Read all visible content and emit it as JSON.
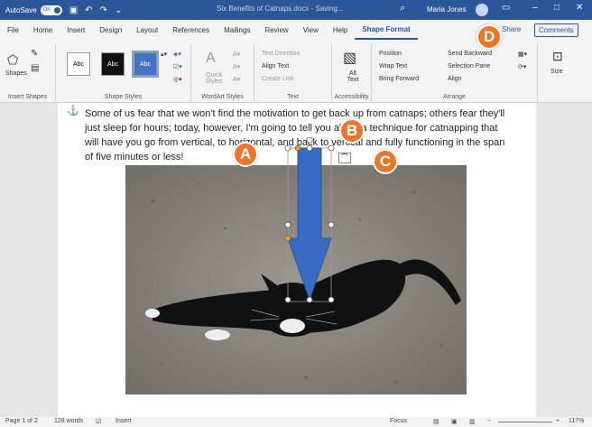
{
  "titlebar": {
    "autosave_label": "AutoSave",
    "autosave_state": "On",
    "doc_title": "Six Benefits of Catnaps.docx - Saving...",
    "user_name": "Maria Jones"
  },
  "tabs": [
    "File",
    "Home",
    "Insert",
    "Design",
    "Layout",
    "References",
    "Mailings",
    "Review",
    "View",
    "Help",
    "Shape Format"
  ],
  "active_tab": "Shape Format",
  "share_label": "Share",
  "comments_label": "Comments",
  "ribbon": {
    "insert_shapes": {
      "label": "Insert Shapes",
      "shapes_btn": "Shapes"
    },
    "shape_styles": {
      "label": "Shape Styles",
      "style1": "Abc",
      "style2": "Abc",
      "style3": "Abc"
    },
    "wordart_styles": {
      "label": "WordArt Styles",
      "quick_styles": "Quick Styles"
    },
    "text": {
      "label": "Text",
      "text_direction": "Text Direction",
      "align_text": "Align Text",
      "create_link": "Create Link"
    },
    "accessibility": {
      "label": "Accessibility",
      "alt_text": "Alt Text"
    },
    "arrange": {
      "label": "Arrange",
      "position": "Position",
      "wrap_text": "Wrap Text",
      "bring_forward": "Bring Forward",
      "send_backward": "Send Backward",
      "selection_pane": "Selection Pane",
      "align": "Align"
    },
    "size": {
      "label": "Size"
    }
  },
  "document": {
    "paragraph": "Some of us fear that we won't find the motivation to get back up from catnaps; others fear they'll just sleep for hours; today, however, I'm going to tell you about a technique for catnapping that will have you go from vertical, to horizontal, and back to vertical and fully functioning in the span of five minutes or less!"
  },
  "statusbar": {
    "page": "Page 1 of 2",
    "words": "128 words",
    "insert": "Insert",
    "focus": "Focus",
    "zoom": "117%"
  },
  "callouts": {
    "a": "A",
    "b": "B",
    "c": "C",
    "d": "D"
  },
  "colors": {
    "accent": "#2b579a",
    "callout": "#e8762c",
    "arrow": "#3a6bc4"
  }
}
